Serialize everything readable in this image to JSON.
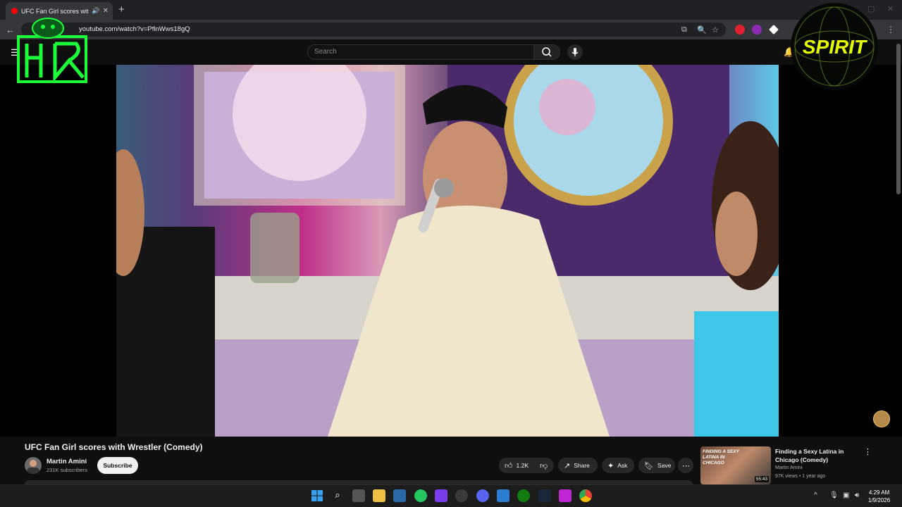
{
  "browser": {
    "tab_title": "UFC Fan Girl scores with Wr",
    "url": "youtube.com/watch?v=PflnWws18gQ",
    "sound_icon": "speaker-icon",
    "close_icon": "close-icon",
    "newtab_icon": "plus-icon"
  },
  "youtube": {
    "search_placeholder": "Search",
    "video": {
      "title": "UFC Fan Girl scores with Wrestler (Comedy)",
      "channel": "Martin Amini",
      "subscribers": "231K subscribers",
      "subscribe_label": "Subscribe",
      "likes": "1.2K",
      "share_label": "Share",
      "ask_label": "Ask",
      "save_label": "Save"
    },
    "recommended": {
      "title": "Finding a Sexy Latina in Chicago (Comedy)",
      "channel": "Martin Amini",
      "meta": "97K views • 1 year ago",
      "duration": "55:43",
      "thumb_text": "FINDING A SEXY LATINA IN CHICAGO"
    }
  },
  "overlay": {
    "right_logo_text": "SPIRIT"
  },
  "taskbar": {
    "time": "4:29 AM",
    "date": "1/9/2026"
  },
  "colors": {
    "page_bg": "#0f0f0f",
    "brand_red": "#ff0000",
    "logo_green": "#1aff3a",
    "logo_yellow": "#e6ff00"
  }
}
